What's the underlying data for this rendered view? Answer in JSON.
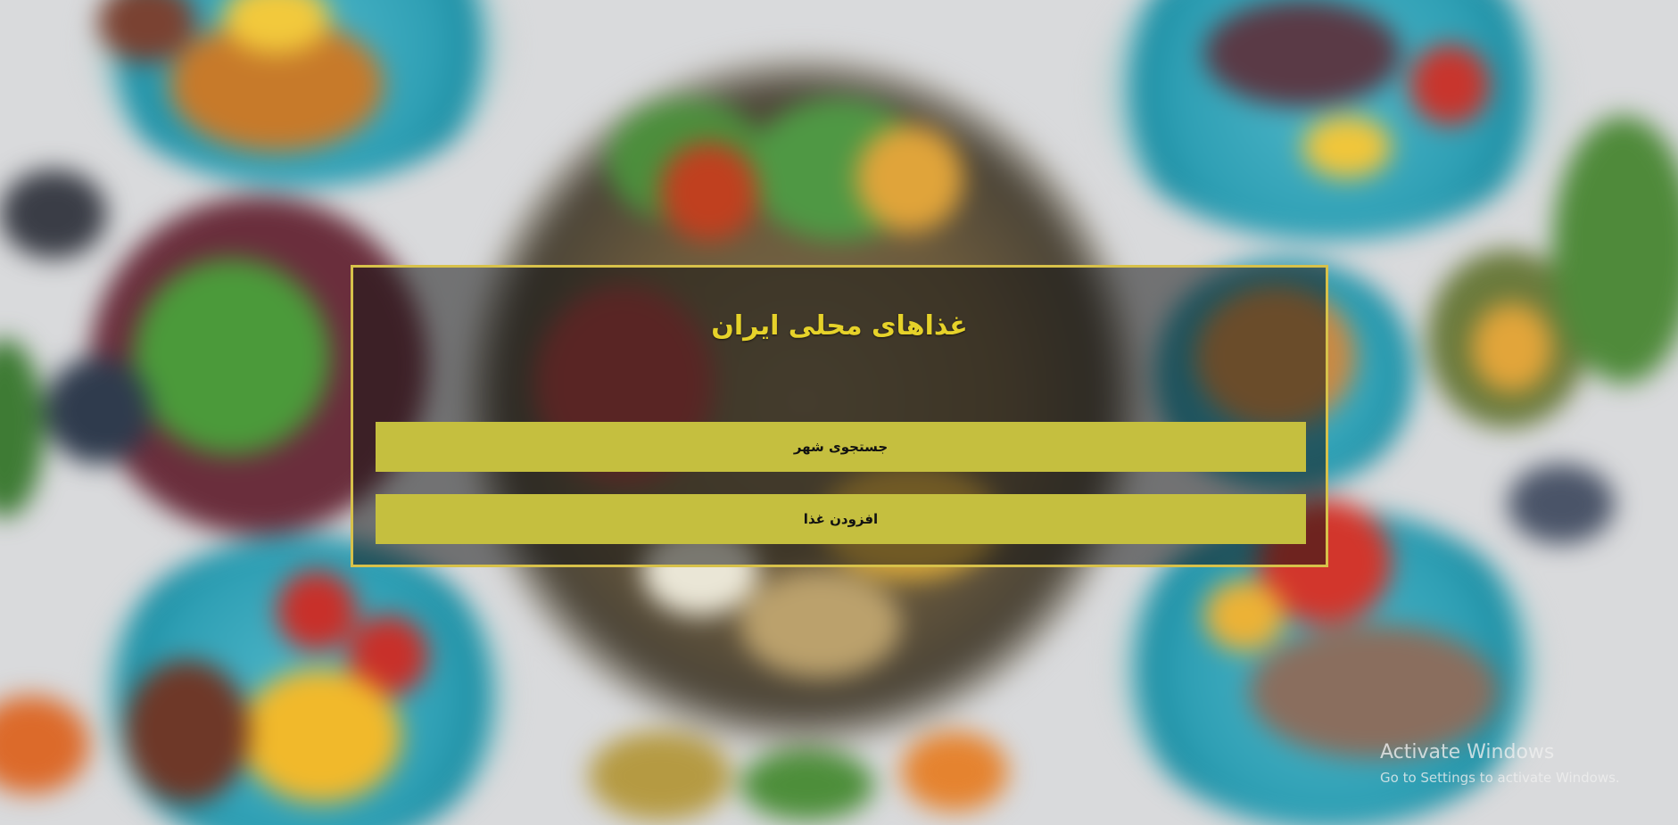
{
  "title": "غذاهای محلی ایران",
  "buttons": {
    "search_city": "جستجوی شهر",
    "add_food": "افزودن غذا"
  },
  "watermark": {
    "title": "Activate Windows",
    "subtitle": "Go to Settings to activate Windows."
  },
  "colors": {
    "accent": "#d7c14a",
    "title_text": "#e6d22a",
    "button_bg": "#c5bf3f"
  }
}
